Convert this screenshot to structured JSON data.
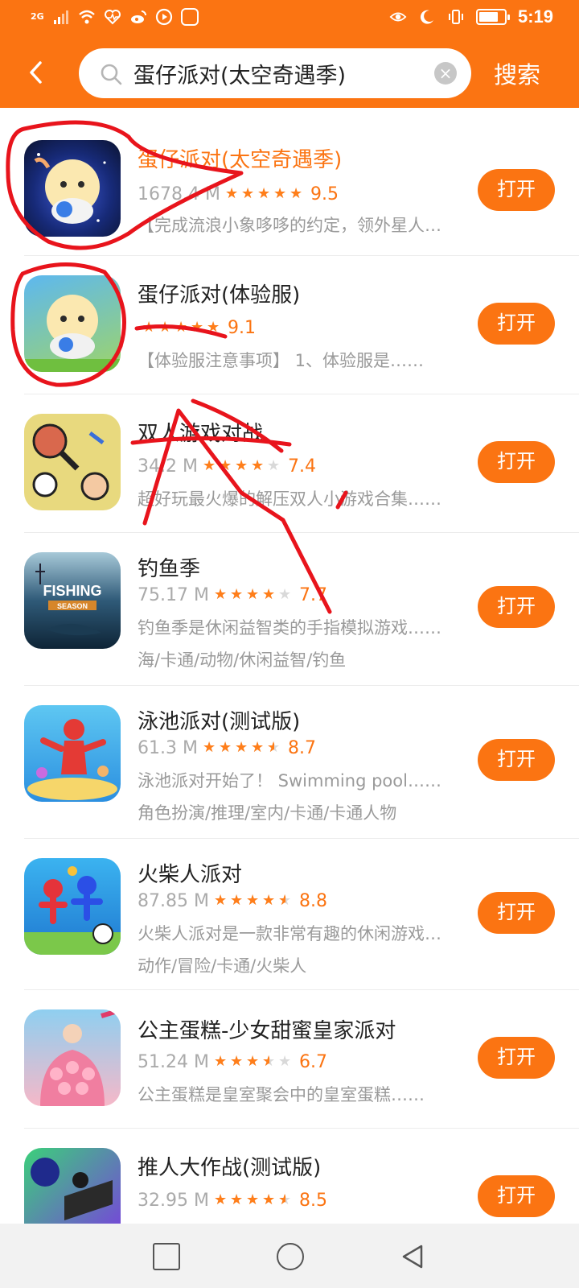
{
  "status_bar": {
    "network_label": "2G",
    "time": "5:19",
    "battery_level": 0.75,
    "left_icons": [
      "signal-icon",
      "wifi-icon",
      "heart-rate-icon",
      "weibo-icon",
      "video-icon",
      "baidu-icon"
    ],
    "right_icons": [
      "eye-icon",
      "moon-icon",
      "vibrate-icon",
      "battery-icon"
    ]
  },
  "header": {
    "search_value": "蛋仔派对(太空奇遇季)",
    "search_button": "搜索",
    "back_icon": "chevron-left-icon",
    "search_icon": "magnifier-icon",
    "clear_icon": "close-icon",
    "clear_symbol": "×"
  },
  "colors": {
    "accent": "#fb7412",
    "star_active": "#ff7e1a",
    "star_inactive": "#d9d9d9",
    "annotation_red": "#e8141c"
  },
  "apps": [
    {
      "name": "蛋仔派对(太空奇遇季)",
      "name_color": "#fb7412",
      "size": "1678.4 M",
      "rating": 5,
      "score": "9.5",
      "description": "【完成流浪小象哆哆的约定，领外星人……",
      "tags": "",
      "button": "打开",
      "icon": "eggy-party-space-icon"
    },
    {
      "name": "蛋仔派对(体验服)",
      "name_color": "#222222",
      "size": "",
      "rating": 5,
      "score": "9.1",
      "description": "【体验服注意事项】 1、体验服是……",
      "tags": "",
      "button": "打开",
      "icon": "eggy-party-test-icon"
    },
    {
      "name": "双人游戏对战",
      "name_color": "#222222",
      "size": "34.2 M",
      "rating": 4,
      "score": "7.4",
      "description": "超好玩最火爆的解压双人小游戏合集……",
      "tags": "",
      "button": "打开",
      "icon": "two-player-games-icon"
    },
    {
      "name": "钓鱼季",
      "name_color": "#222222",
      "size": "75.17 M",
      "rating": 4,
      "score": "7.7",
      "description": "钓鱼季是休闲益智类的手指模拟游戏……",
      "tags": "海/卡通/动物/休闲益智/钓鱼",
      "button": "打开",
      "icon": "fishing-season-icon",
      "icon_text": "FISHING",
      "icon_subtext": "SEASON"
    },
    {
      "name": "泳池派对(测试版)",
      "name_color": "#222222",
      "size": "61.3 M",
      "rating": 4.5,
      "score": "8.7",
      "description": "泳池派对开始了！ Swimming pool……",
      "tags": "角色扮演/推理/室内/卡通/卡通人物",
      "button": "打开",
      "icon": "pool-party-icon"
    },
    {
      "name": "火柴人派对",
      "name_color": "#222222",
      "size": "87.85 M",
      "rating": 4.5,
      "score": "8.8",
      "description": "火柴人派对是一款非常有趣的休闲游戏……",
      "tags": "动作/冒险/卡通/火柴人",
      "button": "打开",
      "icon": "stickman-party-icon"
    },
    {
      "name": "公主蛋糕-少女甜蜜皇家派对",
      "name_color": "#222222",
      "size": "51.24 M",
      "rating": 3.5,
      "score": "6.7",
      "description": "公主蛋糕是皇室聚会中的皇室蛋糕……",
      "tags": "",
      "button": "打开",
      "icon": "princess-cake-icon"
    },
    {
      "name": "推人大作战(测试版)",
      "name_color": "#222222",
      "size": "32.95 M",
      "rating": 4.5,
      "score": "8.5",
      "description": "",
      "tags": "",
      "button": "打开",
      "icon": "push-battle-icon"
    }
  ],
  "nav_bar": {
    "items": [
      "recent-apps-icon",
      "home-icon",
      "back-triangle-icon"
    ]
  }
}
